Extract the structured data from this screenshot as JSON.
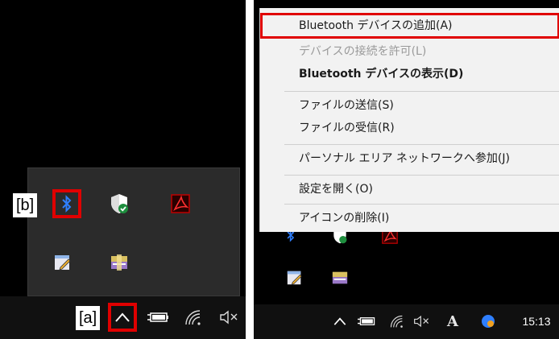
{
  "left": {
    "callout_b": "[b]",
    "callout_a": "[a]",
    "tray_icons": [
      "bluetooth-icon",
      "windows-security-icon",
      "pdf-tool-icon",
      "notepad-icon",
      "archive-icon"
    ],
    "taskbar_icons": [
      "show-hidden-icons-chevron",
      "battery-icon",
      "wifi-icon",
      "volume-muted-icon"
    ]
  },
  "context_menu": {
    "items": [
      {
        "label": "Bluetooth デバイスの追加(A)",
        "state": "highlighted"
      },
      {
        "label": "デバイスの接続を許可(L)",
        "state": "disabled"
      },
      {
        "label": "Bluetooth デバイスの表示(D)",
        "state": "bold"
      },
      {
        "label": "ファイルの送信(S)",
        "state": "normal"
      },
      {
        "label": "ファイルの受信(R)",
        "state": "normal"
      },
      {
        "label": "パーソナル エリア ネットワークへ参加(J)",
        "state": "normal"
      },
      {
        "label": "設定を開く(O)",
        "state": "normal"
      },
      {
        "label": "アイコンの削除(I)",
        "state": "normal"
      }
    ]
  },
  "right_taskbar": {
    "ime_indicator": "A",
    "clock": "15:13"
  },
  "colors": {
    "highlight": "#e00000",
    "bluetooth": "#2f7fff",
    "shield": "#1e8e3e"
  }
}
